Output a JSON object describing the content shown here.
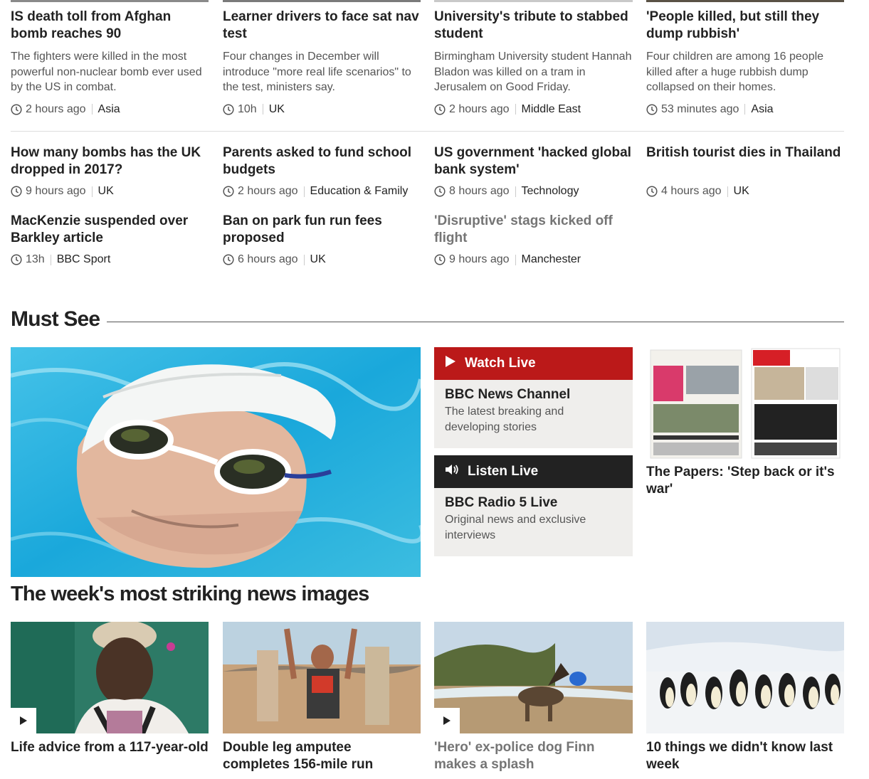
{
  "stories_row1": [
    {
      "headline": "IS death toll from Afghan bomb reaches 90",
      "summary": "The fighters were killed in the most powerful non-nuclear bomb ever used by the US in combat.",
      "time": "2 hours ago",
      "tag": "Asia"
    },
    {
      "headline": "Learner drivers to face sat nav test",
      "summary": "Four changes in December will introduce \"more real life scenarios\" to the test, ministers say.",
      "time": "10h",
      "tag": "UK"
    },
    {
      "headline": "University's tribute to stabbed student",
      "summary": "Birmingham University student Hannah Bladon was killed on a tram in Jerusalem on Good Friday.",
      "time": "2 hours ago",
      "tag": "Middle East"
    },
    {
      "headline": "'People killed, but still they dump rubbish'",
      "summary": "Four children are among 16 people killed after a huge rubbish dump collapsed on their homes.",
      "time": "53 minutes ago",
      "tag": "Asia"
    }
  ],
  "stories_row2": [
    {
      "headline": "How many bombs has the UK dropped in 2017?",
      "time": "9 hours ago",
      "tag": "UK"
    },
    {
      "headline": "Parents asked to fund school budgets",
      "time": "2 hours ago",
      "tag": "Education & Family"
    },
    {
      "headline": "US government 'hacked global bank system'",
      "time": "8 hours ago",
      "tag": "Technology"
    },
    {
      "headline": "British tourist dies in Thailand",
      "time": "4 hours ago",
      "tag": "UK"
    }
  ],
  "stories_row3": [
    {
      "headline": "MacKenzie suspended over Barkley article",
      "time": "13h",
      "tag": "BBC Sport"
    },
    {
      "headline": "Ban on park fun run fees proposed",
      "time": "6 hours ago",
      "tag": "UK"
    },
    {
      "headline": "'Disruptive' stags kicked off flight",
      "time": "9 hours ago",
      "tag": "Manchester"
    }
  ],
  "must_see": {
    "title": "Must See",
    "hero_title": "The week's most striking news images",
    "watch_live": {
      "label": "Watch Live",
      "name": "BBC News Channel",
      "desc": "The latest breaking and developing stories"
    },
    "listen_live": {
      "label": "Listen Live",
      "name": "BBC Radio 5 Live",
      "desc": "Original news and exclusive interviews"
    },
    "papers": {
      "title": "The Papers: 'Step back or it's war'"
    }
  },
  "thumbs": [
    {
      "title": "Life advice from a 117-year-old",
      "video": true
    },
    {
      "title": "Double leg amputee completes 156-mile run",
      "video": false
    },
    {
      "title": "'Hero' ex-police dog Finn makes a splash",
      "video": true
    },
    {
      "title": "10 things we didn't know last week",
      "video": false
    }
  ],
  "colors": {
    "watch_live": "#bb1919",
    "listen_live": "#222222",
    "card_bg": "#efeeec"
  }
}
